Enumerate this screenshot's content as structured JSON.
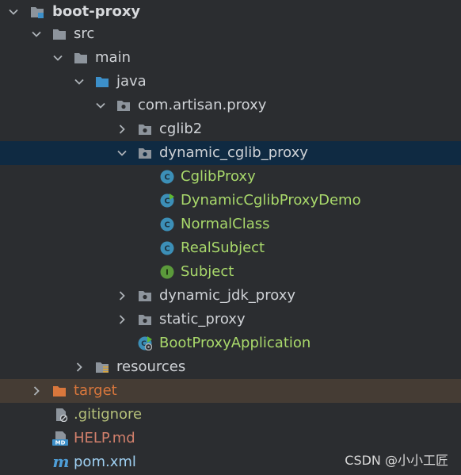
{
  "tree": {
    "root": "boot-proxy",
    "src": "src",
    "main": "main",
    "java": "java",
    "package": "com.artisan.proxy",
    "cglib2": "cglib2",
    "dynamic_cglib_proxy": "dynamic_cglib_proxy",
    "cglib_proxy": "CglibProxy",
    "dynamic_cglib_proxy_demo": "DynamicCglibProxyDemo",
    "normal_class": "NormalClass",
    "real_subject": "RealSubject",
    "subject": "Subject",
    "dynamic_jdk_proxy": "dynamic_jdk_proxy",
    "static_proxy": "static_proxy",
    "boot_proxy_application": "BootProxyApplication",
    "resources": "resources",
    "target": "target",
    "gitignore": ".gitignore",
    "help_md": "HELP.md",
    "pom_xml": "pom.xml"
  },
  "icon_letters": {
    "class": "C",
    "interface": "I",
    "md": "MD",
    "maven": "m"
  },
  "watermark": "CSDN @小小工匠",
  "colors": {
    "background": "#2b2d30",
    "selected_row": "#0f2a42",
    "excluded_row": "#453c34",
    "class_icon": "#3c8fb7",
    "interface_icon": "#5b9a3b",
    "folder_gray": "#8d949c",
    "folder_blue": "#3c8fc9",
    "folder_orange": "#d9773c"
  }
}
